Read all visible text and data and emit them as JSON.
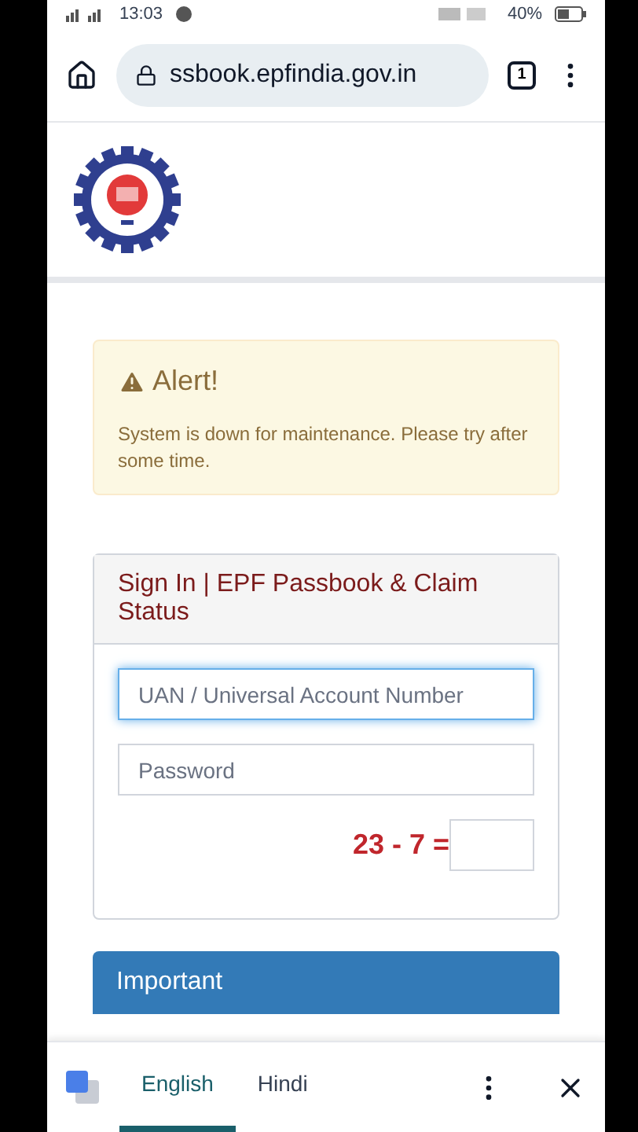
{
  "status_bar": {
    "time": "13:03",
    "battery": "40%"
  },
  "browser": {
    "url": "ssbook.epfindia.gov.in",
    "tab_count": "1"
  },
  "alert": {
    "title": "Alert!",
    "message": "System is down for maintenance. Please try after some time."
  },
  "sign_in": {
    "title": "Sign In | EPF Passbook & Claim Status",
    "uan": {
      "placeholder": "UAN / Universal Account Number"
    },
    "password": {
      "placeholder": "Password"
    },
    "captcha": "23 - 7 ="
  },
  "important": {
    "title": "Important"
  },
  "translate_bar": {
    "languages": [
      {
        "label": "English",
        "selected": true
      },
      {
        "label": "Hindi",
        "selected": false
      }
    ]
  }
}
